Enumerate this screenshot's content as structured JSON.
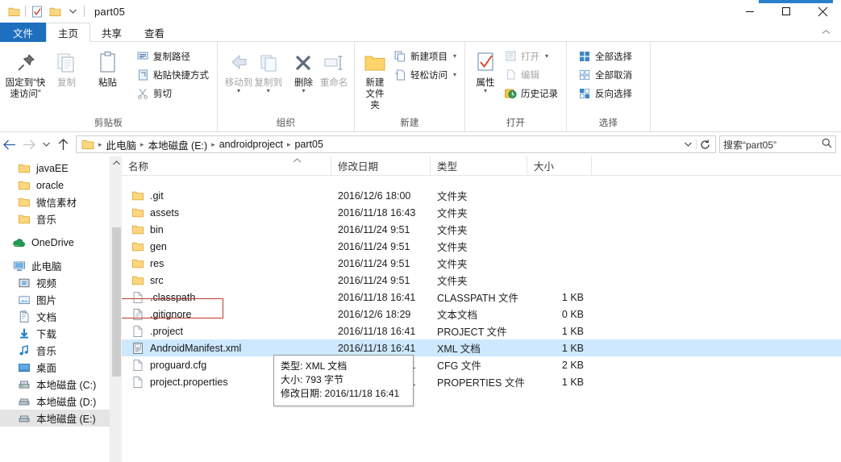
{
  "window": {
    "title": "part05",
    "quick_access": [
      "folder-icon",
      "properties-icon",
      "new-folder-icon",
      "customize-dropdown-icon"
    ],
    "controls": {
      "minimize": "—",
      "maximize": "□",
      "close": "✕"
    },
    "accent_color": "#2a7fc9"
  },
  "ribbon": {
    "tabs": [
      {
        "label": "文件",
        "type": "file"
      },
      {
        "label": "主页",
        "type": "active"
      },
      {
        "label": "共享",
        "type": "normal"
      },
      {
        "label": "查看",
        "type": "normal"
      }
    ],
    "collapse_icon": "chevron-up-icon",
    "groups": [
      {
        "label": "剪贴板",
        "big_buttons": [
          {
            "label": "固定到“快速访问”",
            "icon": "pin-icon",
            "dim": false
          },
          {
            "label": "复制",
            "icon": "copy-icon",
            "dim": true
          },
          {
            "label": "粘贴",
            "icon": "paste-icon",
            "dim": false
          }
        ],
        "small_buttons": [
          {
            "label": "复制路径",
            "icon": "copy-path-icon",
            "dim": false
          },
          {
            "label": "粘贴快捷方式",
            "icon": "paste-shortcut-icon",
            "dim": false
          },
          {
            "label": "剪切",
            "icon": "scissors-icon",
            "dim": false
          }
        ]
      },
      {
        "label": "组织",
        "big_buttons": [
          {
            "label": "移动到",
            "icon": "move-to-icon",
            "dim": true
          },
          {
            "label": "复制到",
            "icon": "copy-to-icon",
            "dim": true
          },
          {
            "label": "删除",
            "icon": "delete-x-icon",
            "dim": false
          },
          {
            "label": "重命名",
            "icon": "rename-icon",
            "dim": true
          }
        ],
        "small_buttons": []
      },
      {
        "label": "新建",
        "big_buttons": [
          {
            "label": "新建文件夹",
            "icon": "new-folder-icon",
            "dim": false
          }
        ],
        "small_buttons": [
          {
            "label": "新建项目",
            "icon": "new-item-icon",
            "dim": false
          },
          {
            "label": "轻松访问",
            "icon": "easy-access-icon",
            "dim": false
          }
        ]
      },
      {
        "label": "打开",
        "big_buttons": [
          {
            "label": "属性",
            "icon": "properties-icon",
            "dim": false
          }
        ],
        "small_buttons": [
          {
            "label": "打开",
            "icon": "open-icon",
            "dim": true
          },
          {
            "label": "编辑",
            "icon": "edit-icon",
            "dim": true
          },
          {
            "label": "历史记录",
            "icon": "history-icon",
            "dim": false
          }
        ]
      },
      {
        "label": "选择",
        "big_buttons": [],
        "small_buttons": [
          {
            "label": "全部选择",
            "icon": "select-all-icon",
            "dim": false
          },
          {
            "label": "全部取消",
            "icon": "select-none-icon",
            "dim": false
          },
          {
            "label": "反向选择",
            "icon": "invert-selection-icon",
            "dim": false
          }
        ]
      }
    ]
  },
  "navbar": {
    "back_icon": "arrow-left-icon",
    "forward_icon": "arrow-right-icon",
    "recent_icon": "chevron-down-icon",
    "up_icon": "arrow-up-icon",
    "breadcrumbs": [
      "此电脑",
      "本地磁盘 (E:)",
      "androidproject",
      "part05"
    ],
    "dropdown_icon": "chevron-down-icon",
    "refresh_icon": "refresh-icon",
    "search": {
      "value": "搜索“part05”",
      "icon": "search-icon"
    }
  },
  "navpane": {
    "items": [
      {
        "label": "javaEE",
        "icon": "folder-icon",
        "indent": 1,
        "selected": false
      },
      {
        "label": "oracle",
        "icon": "folder-icon",
        "indent": 1,
        "selected": false
      },
      {
        "label": "微信素材",
        "icon": "folder-icon",
        "indent": 1,
        "selected": false
      },
      {
        "label": "音乐",
        "icon": "folder-icon",
        "indent": 1,
        "selected": false
      },
      {
        "label": "OneDrive",
        "icon": "onedrive-icon",
        "indent": 0,
        "selected": false,
        "gap_before": true
      },
      {
        "label": "此电脑",
        "icon": "this-pc-icon",
        "indent": 0,
        "selected": false,
        "gap_before": true
      },
      {
        "label": "视频",
        "icon": "videos-icon",
        "indent": 1,
        "selected": false
      },
      {
        "label": "图片",
        "icon": "pictures-icon",
        "indent": 1,
        "selected": false
      },
      {
        "label": "文档",
        "icon": "documents-icon",
        "indent": 1,
        "selected": false
      },
      {
        "label": "下载",
        "icon": "downloads-icon",
        "indent": 1,
        "selected": false
      },
      {
        "label": "音乐",
        "icon": "music-icon",
        "indent": 1,
        "selected": false
      },
      {
        "label": "桌面",
        "icon": "desktop-icon",
        "indent": 1,
        "selected": false
      },
      {
        "label": "本地磁盘 (C:)",
        "icon": "os-drive-icon",
        "indent": 1,
        "selected": false
      },
      {
        "label": "本地磁盘 (D:)",
        "icon": "drive-icon",
        "indent": 1,
        "selected": false
      },
      {
        "label": "本地磁盘 (E:)",
        "icon": "drive-icon",
        "indent": 1,
        "selected": true
      }
    ]
  },
  "filelist": {
    "columns": [
      {
        "label": "名称",
        "key": "name"
      },
      {
        "label": "修改日期",
        "key": "date"
      },
      {
        "label": "类型",
        "key": "type"
      },
      {
        "label": "大小",
        "key": "size"
      }
    ],
    "sort_indicator": "chevron-up-icon",
    "rows": [
      {
        "name": ".git",
        "date": "2016/12/6 18:00",
        "type": "文件夹",
        "size": "",
        "icon": "folder-icon",
        "selected": false
      },
      {
        "name": "assets",
        "date": "2016/11/18 16:43",
        "type": "文件夹",
        "size": "",
        "icon": "folder-icon",
        "selected": false
      },
      {
        "name": "bin",
        "date": "2016/11/24 9:51",
        "type": "文件夹",
        "size": "",
        "icon": "folder-icon",
        "selected": false
      },
      {
        "name": "gen",
        "date": "2016/11/24 9:51",
        "type": "文件夹",
        "size": "",
        "icon": "folder-icon",
        "selected": false
      },
      {
        "name": "res",
        "date": "2016/11/24 9:51",
        "type": "文件夹",
        "size": "",
        "icon": "folder-icon",
        "selected": false
      },
      {
        "name": "src",
        "date": "2016/11/24 9:51",
        "type": "文件夹",
        "size": "",
        "icon": "folder-icon",
        "selected": false
      },
      {
        "name": ".classpath",
        "date": "2016/11/18 16:41",
        "type": "CLASSPATH 文件",
        "size": "1 KB",
        "icon": "file-blank-icon",
        "selected": false
      },
      {
        "name": ".gitignore",
        "date": "2016/12/6 18:29",
        "type": "文本文档",
        "size": "0 KB",
        "icon": "file-text-icon",
        "selected": false
      },
      {
        "name": ".project",
        "date": "2016/11/18 16:41",
        "type": "PROJECT 文件",
        "size": "1 KB",
        "icon": "file-blank-icon",
        "selected": false
      },
      {
        "name": "AndroidManifest.xml",
        "date": "2016/11/18 16:41",
        "type": "XML 文档",
        "size": "1 KB",
        "icon": "file-xml-icon",
        "selected": true
      },
      {
        "name": "proguard.cfg",
        "date": "2016/11/18 16:41",
        "type": "CFG 文件",
        "size": "2 KB",
        "icon": "file-blank-icon",
        "selected": false
      },
      {
        "name": "project.properties",
        "date": "2016/11/18 16:41",
        "type": "PROPERTIES 文件",
        "size": "1 KB",
        "icon": "file-blank-icon",
        "selected": false
      }
    ]
  },
  "tooltip": {
    "lines": [
      "类型: XML 文档",
      "大小: 793 字节",
      "修改日期: 2016/11/18 16:41"
    ]
  },
  "annotation": {
    "highlight_color": "#c0392b",
    "target_row": ".gitignore"
  }
}
